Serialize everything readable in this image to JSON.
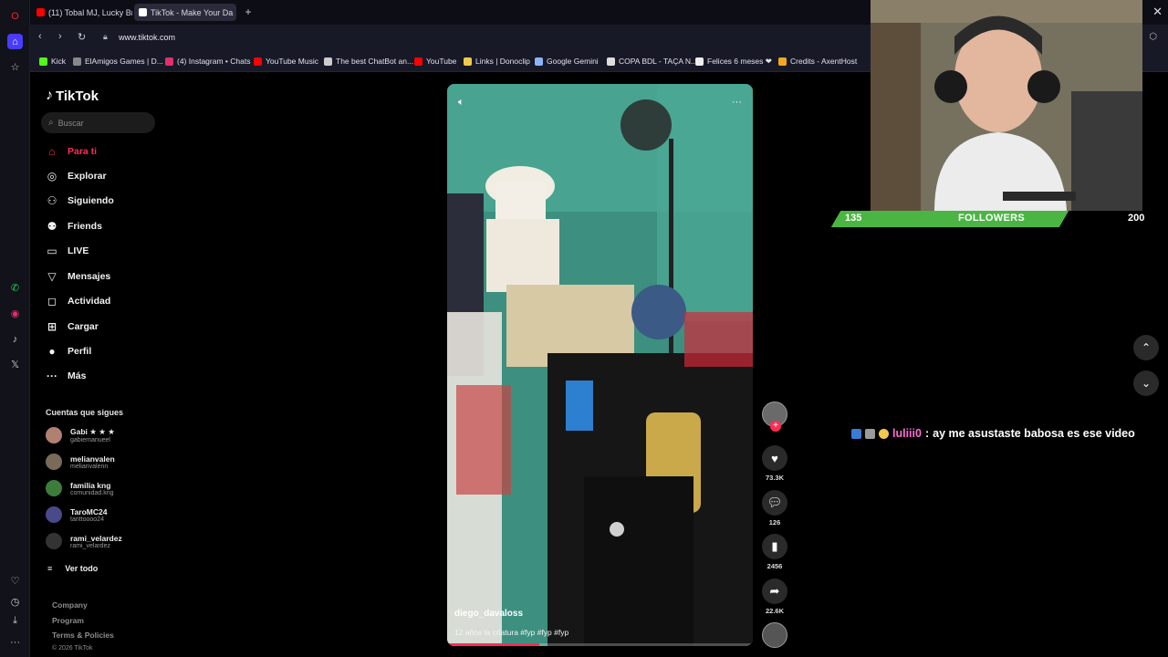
{
  "browser": {
    "tabs": [
      {
        "title": "(11) Tobal MJ, Lucky Brow",
        "favicon_color": "#ff0000",
        "active": false
      },
      {
        "title": "TikTok - Make Your Da",
        "favicon_color": "#ffffff",
        "active": true
      }
    ],
    "url": "www.tiktok.com",
    "bookmarks": [
      {
        "label": "Kick",
        "color": "#53fc18"
      },
      {
        "label": "ElAmigos Games | D...",
        "color": "#888888"
      },
      {
        "label": "(4) Instagram • Chats",
        "color": "#e1306c"
      },
      {
        "label": "YouTube Music",
        "color": "#ff0000"
      },
      {
        "label": "The best ChatBot an...",
        "color": "#cccccc"
      },
      {
        "label": "YouTube",
        "color": "#ff0000"
      },
      {
        "label": "Links | Donoclip",
        "color": "#f2c94c"
      },
      {
        "label": "Google Gemini",
        "color": "#8ab4f8"
      },
      {
        "label": "COPA BDL - TAÇA N...",
        "color": "#dddddd"
      },
      {
        "label": "Felices 6 meses ❤",
        "color": "#eeeeee"
      },
      {
        "label": "Credits - AxentHost",
        "color": "#f5a623"
      }
    ],
    "rail_icons": [
      "opera-icon",
      "home-icon",
      "star-icon",
      "whatsapp-icon",
      "instagram-icon",
      "tiktok-icon",
      "x-icon",
      "heart-icon",
      "history-icon",
      "download-icon",
      "more-icon"
    ]
  },
  "tiktok": {
    "logo": "TikTok",
    "search_placeholder": "Buscar",
    "nav": [
      {
        "label": "Para ti",
        "icon": "home-icon",
        "glyph": "⌂",
        "active": true
      },
      {
        "label": "Explorar",
        "icon": "compass-icon",
        "glyph": "◎",
        "active": false
      },
      {
        "label": "Siguiendo",
        "icon": "following-icon",
        "glyph": "⚇",
        "active": false
      },
      {
        "label": "Friends",
        "icon": "friends-icon",
        "glyph": "⚉",
        "active": false
      },
      {
        "label": "LIVE",
        "icon": "live-icon",
        "glyph": "▭",
        "active": false
      },
      {
        "label": "Mensajes",
        "icon": "messages-icon",
        "glyph": "▽",
        "active": false
      },
      {
        "label": "Actividad",
        "icon": "activity-icon",
        "glyph": "◻",
        "active": false
      },
      {
        "label": "Cargar",
        "icon": "upload-icon",
        "glyph": "⊞",
        "active": false
      },
      {
        "label": "Perfil",
        "icon": "profile-icon",
        "glyph": "●",
        "active": false
      },
      {
        "label": "Más",
        "icon": "more-icon",
        "glyph": "···",
        "active": false
      }
    ],
    "following_header": "Cuentas que sigues",
    "following": [
      {
        "name": "Gabi ★ ★ ★",
        "username": "gabiemanueel",
        "avatar_color": "#b08070"
      },
      {
        "name": "melianvalen",
        "username": "melianvalenn",
        "avatar_color": "#7a6a5a"
      },
      {
        "name": "familia kng",
        "username": "comunidad.kng",
        "avatar_color": "#3c7d3c"
      },
      {
        "name": "TaroMC24",
        "username": "tarittoooo24",
        "avatar_color": "#4a4a8a"
      },
      {
        "name": "rami_velardez",
        "username": "rami_velardez",
        "avatar_color": "#333333"
      }
    ],
    "see_all": "Ver todo",
    "footer": [
      "Company",
      "Program",
      "Terms & Policies"
    ],
    "copyright": "© 2026 TikTok"
  },
  "video": {
    "author": "diego_davaloss",
    "description": "12 años la criatura #fyp #fyp #fyp",
    "progress": 0.3,
    "likes": "73.3K",
    "comments": "126",
    "saves": "2456",
    "shares": "22.6K"
  },
  "stream": {
    "followers_current": "135",
    "followers_label": "FOLLOWERS",
    "followers_goal": "200",
    "followers_bar_color": "#4bb543",
    "chat_user": "luliii0",
    "chat_separator": ":",
    "chat_message": "ay me asustaste babosa es ese video"
  }
}
